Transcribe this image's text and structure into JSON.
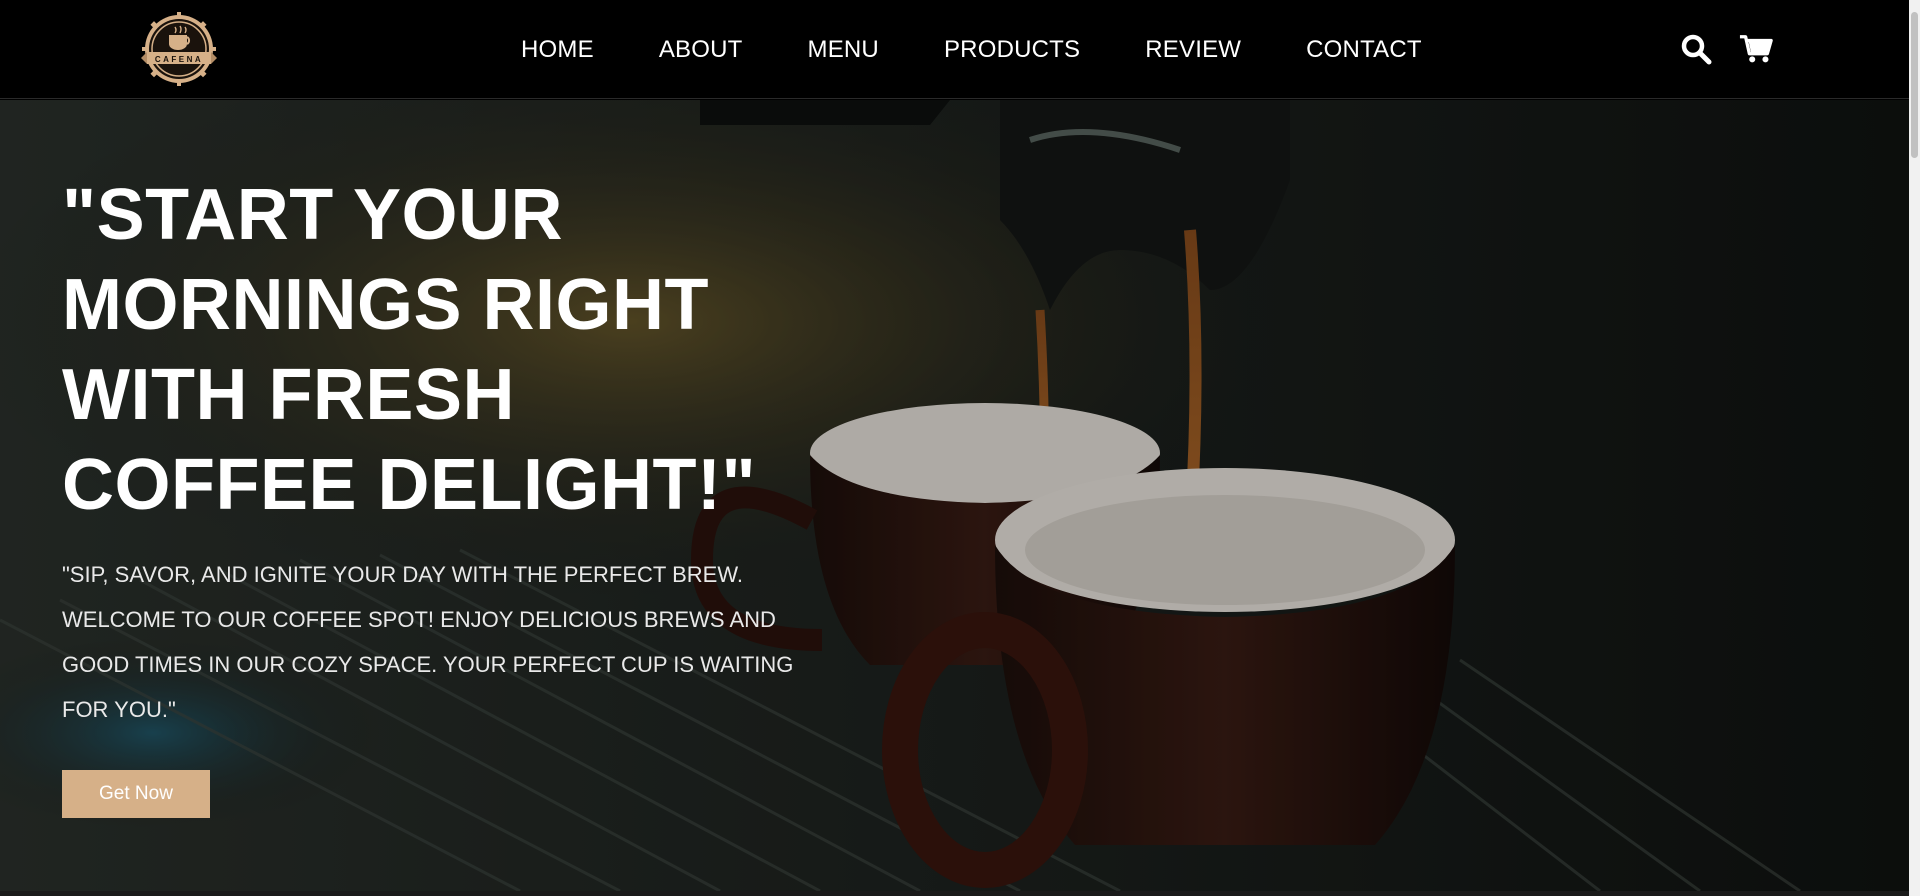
{
  "brand": {
    "logo_text": "CAFENA"
  },
  "nav": {
    "items": [
      {
        "label": "HOME"
      },
      {
        "label": "ABOUT"
      },
      {
        "label": "MENU"
      },
      {
        "label": "PRODUCTS"
      },
      {
        "label": "REVIEW"
      },
      {
        "label": "CONTACT"
      }
    ]
  },
  "header_icons": [
    "search-icon",
    "cart-icon"
  ],
  "hero": {
    "title": "\"START YOUR MORNINGS RIGHT WITH FRESH COFFEE DELIGHT!\"",
    "subtitle": "\"SIP, SAVOR, AND IGNITE YOUR DAY WITH THE PERFECT BREW. WELCOME TO OUR COFFEE SPOT! ENJOY DELICIOUS BREWS AND GOOD TIMES IN OUR COZY SPACE. YOUR PERFECT CUP IS WAITING FOR YOU.\"",
    "cta_label": "Get Now",
    "background_image": "espresso-machine-pouring-into-two-cups"
  },
  "colors": {
    "header_bg": "#000000",
    "accent": "#d6b088",
    "text": "#ffffff"
  }
}
